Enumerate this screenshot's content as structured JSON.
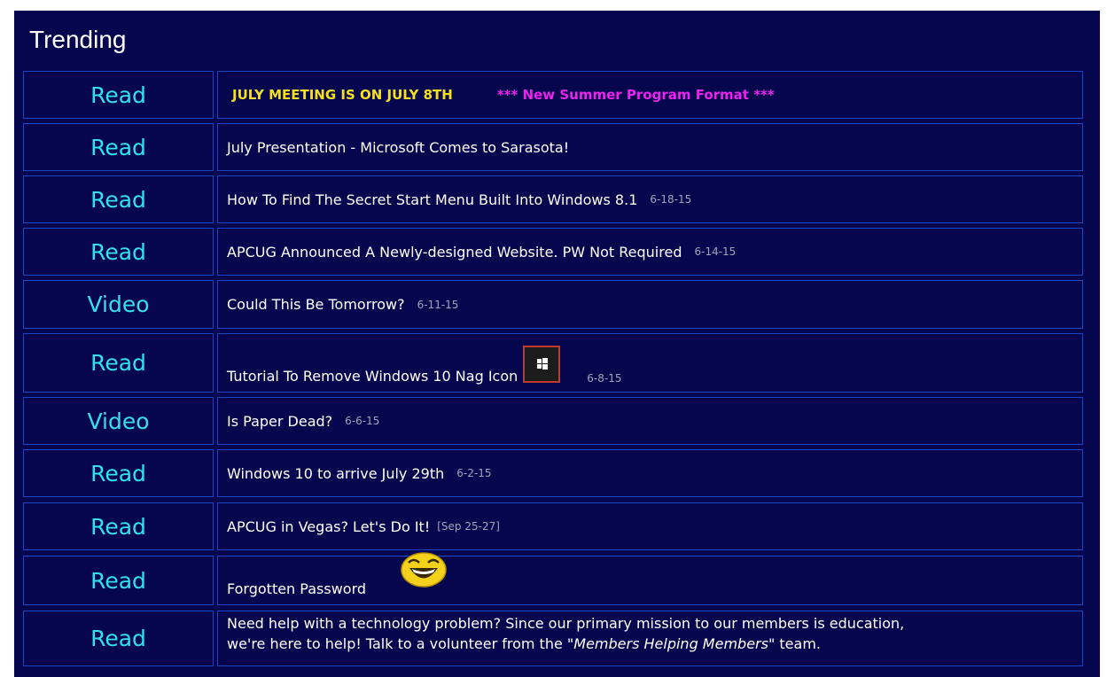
{
  "heading": "Trending",
  "rows": [
    {
      "action": "Read",
      "meeting": "JULY MEETING IS ON JULY 8TH",
      "format": "*** New Summer Program Format ***"
    },
    {
      "action": "Read",
      "title": "July Presentation - Microsoft Comes to Sarasota!"
    },
    {
      "action": "Read",
      "title": "How To Find The Secret Start Menu Built Into Windows 8.1",
      "date": "6-18-15"
    },
    {
      "action": "Read",
      "title": "APCUG Announced A Newly-designed Website. PW Not Required",
      "date": "6-14-15"
    },
    {
      "action": "Video",
      "title": "Could This Be Tomorrow?",
      "date": "6-11-15"
    },
    {
      "action": "Read",
      "title": "Tutorial To Remove Windows 10 Nag Icon",
      "icon": "windows-logo-icon",
      "date": "6-8-15"
    },
    {
      "action": "Video",
      "title": "Is Paper Dead?",
      "date": "6-6-15"
    },
    {
      "action": "Read",
      "title": "Windows 10 to arrive July 29th",
      "date": "6-2-15"
    },
    {
      "action": "Read",
      "title": "APCUG in Vegas? Let's Do It!",
      "date": "[Sep 25-27]"
    },
    {
      "action": "Read",
      "title": "Forgotten Password",
      "icon": "laughing-smiley-icon"
    },
    {
      "action": "Read",
      "line1": "Need help with a technology problem?  Since our primary mission to our members is education,",
      "line2a": "we're here to help!  Talk to a volunteer from the ",
      "line2b": "\"Members Helping Members\"",
      "line2c": "  team."
    }
  ],
  "colors": {
    "background": "#06064f",
    "border": "#1a45c4",
    "action_text": "#33e0f0",
    "meeting_text": "#f5e020",
    "format_text": "#ee22ee",
    "date_text": "#a3a3b8"
  }
}
